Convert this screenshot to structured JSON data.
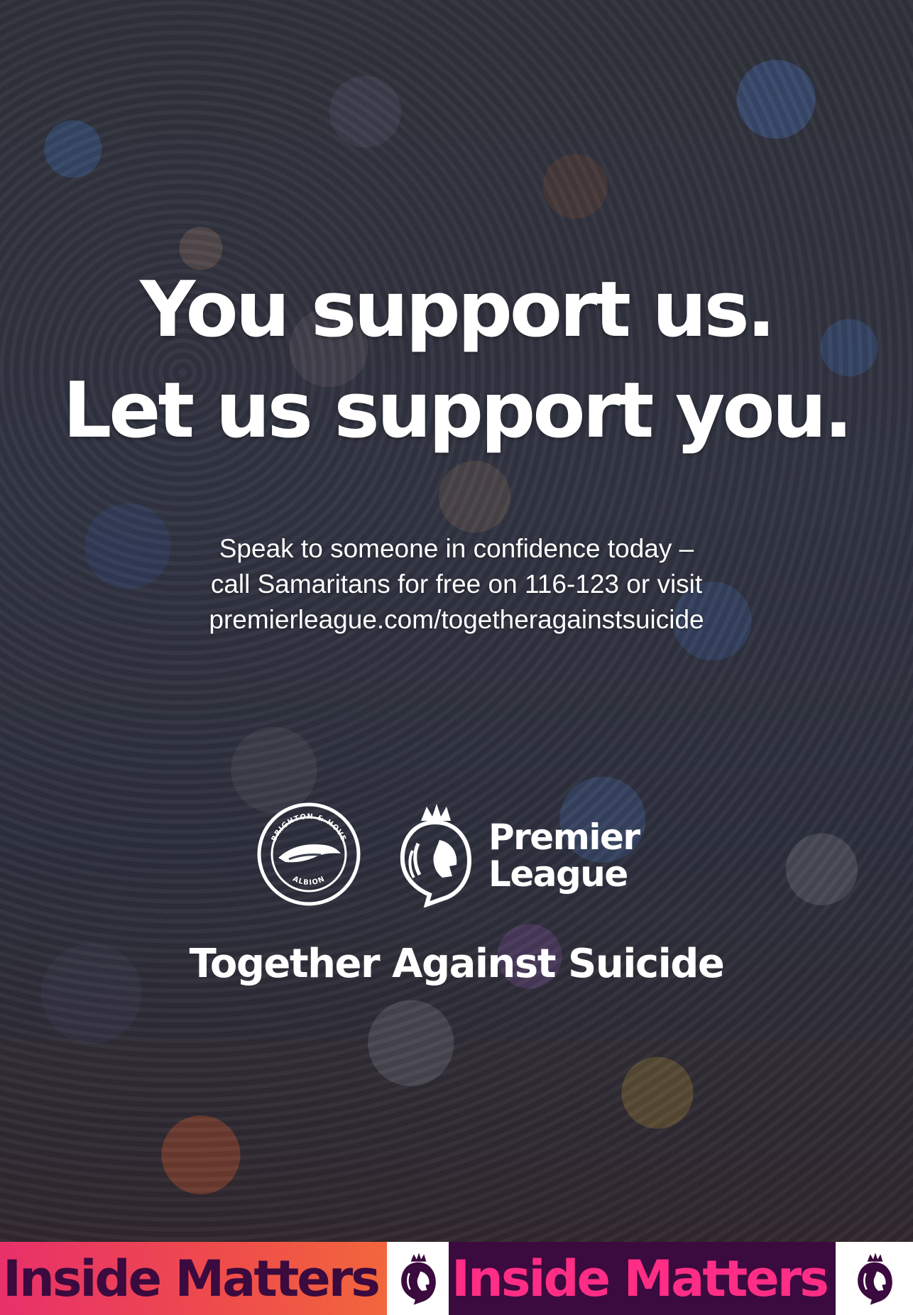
{
  "headline": {
    "line1": "You support us.",
    "line2": "Let us support you."
  },
  "subtext": {
    "line1": "Speak to someone in confidence today –",
    "line2": "call Samaritans for free on 116-123 or visit",
    "line3": "premierleague.com/togetheragainstsuicide"
  },
  "logos": {
    "club_crest_top": "BRIGHTON & HOVE",
    "club_crest_bottom": "ALBION",
    "league_line1": "Premier",
    "league_line2": "League"
  },
  "tagline": "Together Against Suicide",
  "banner": {
    "panel1_text": "Inside Matters",
    "panel2_text": "Inside Matters"
  },
  "colors": {
    "banner_gradient_start": "#e8306a",
    "banner_gradient_end": "#f2663c",
    "banner_dark": "#3b0a3e",
    "banner_pink": "#ff2d85",
    "text": "#ffffff"
  },
  "icons": [
    "brighton-crest-icon",
    "premier-league-lion-icon"
  ]
}
